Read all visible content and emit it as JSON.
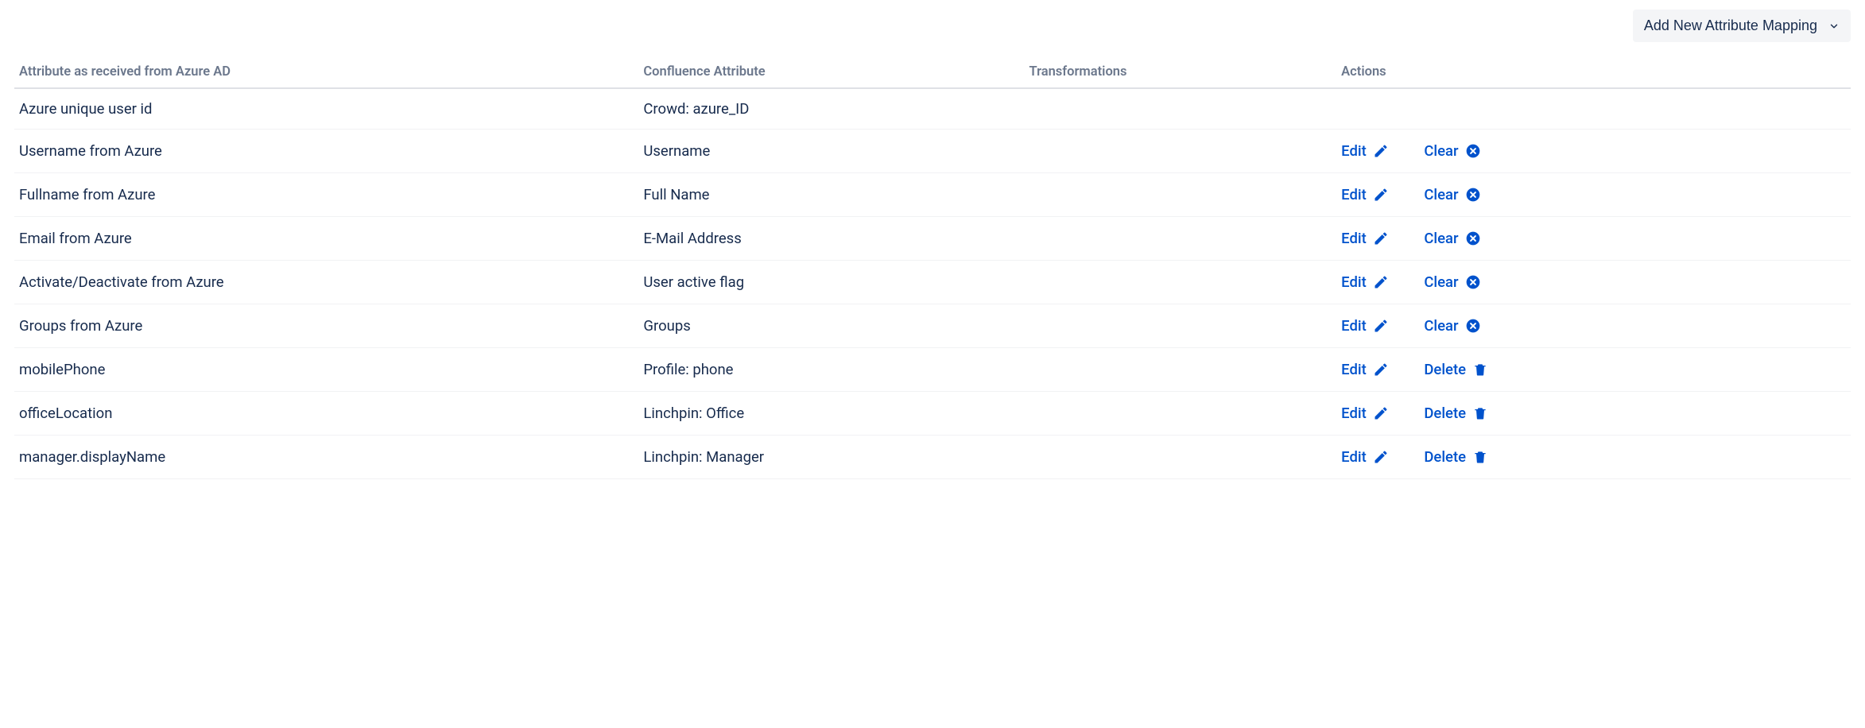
{
  "toolbar": {
    "add_button_label": "Add New Attribute Mapping"
  },
  "table": {
    "headers": {
      "source": "Attribute as received from Azure AD",
      "confluence": "Confluence Attribute",
      "transformations": "Transformations",
      "actions": "Actions"
    },
    "action_labels": {
      "edit": "Edit",
      "clear": "Clear",
      "delete": "Delete"
    },
    "rows": [
      {
        "source": "Azure unique user id",
        "confluence": "Crowd: azure_ID",
        "transformations": "",
        "action_type": "none"
      },
      {
        "source": "Username from Azure",
        "confluence": "Username",
        "transformations": "",
        "action_type": "clear"
      },
      {
        "source": "Fullname from Azure",
        "confluence": "Full Name",
        "transformations": "",
        "action_type": "clear"
      },
      {
        "source": "Email from Azure",
        "confluence": "E-Mail Address",
        "transformations": "",
        "action_type": "clear"
      },
      {
        "source": "Activate/Deactivate from Azure",
        "confluence": "User active flag",
        "transformations": "",
        "action_type": "clear"
      },
      {
        "source": "Groups from Azure",
        "confluence": "Groups",
        "transformations": "",
        "action_type": "clear"
      },
      {
        "source": "mobilePhone",
        "confluence": "Profile: phone",
        "transformations": "",
        "action_type": "delete"
      },
      {
        "source": "officeLocation",
        "confluence": "Linchpin: Office",
        "transformations": "",
        "action_type": "delete"
      },
      {
        "source": "manager.displayName",
        "confluence": "Linchpin: Manager",
        "transformations": "",
        "action_type": "delete"
      }
    ]
  }
}
